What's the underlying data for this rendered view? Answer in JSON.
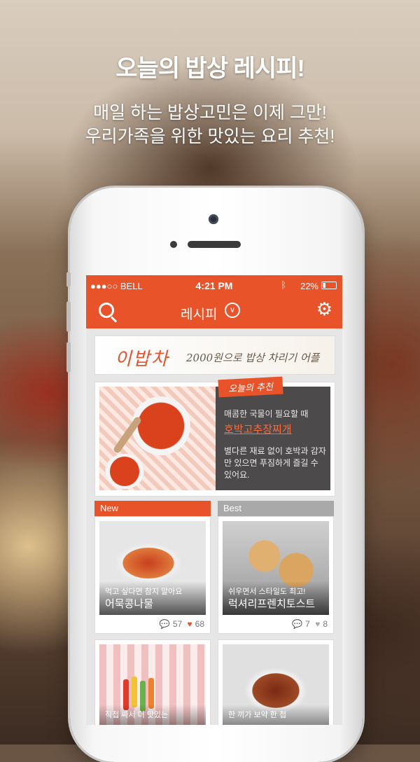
{
  "promo": {
    "headline": "오늘의 밥상 레시피!",
    "line1": "매일 하는 밥상고민은 이제 그만!",
    "line2": "우리가족을 위한 맛있는 요리 추천!"
  },
  "status_bar": {
    "carrier": "●●●○○ BELL",
    "time": "4:21 PM",
    "battery": "22%"
  },
  "nav": {
    "title": "레시피",
    "chevron": "∨"
  },
  "banner": {
    "brand": "이밥차",
    "tagline": "2000원으로 밥상 차리기 어플"
  },
  "featured": {
    "tag": "오늘의 추천",
    "subtitle": "매콤한 국물이 필요할 때",
    "title": "호박고추장찌개",
    "description": "별다른 재료 없이 호박과 감자만 있으면 푸짐하게 즐길 수 있어요."
  },
  "sections": {
    "new_label": "New",
    "best_label": "Best"
  },
  "cards": [
    {
      "subtitle": "먹고 싶다면 참지 말아요",
      "title": "어묵콩나물",
      "comments": "57",
      "likes": "68"
    },
    {
      "subtitle": "쉬우면서 스타일도 최고!",
      "title": "럭셔리프렌치토스트",
      "comments": "7",
      "likes": "8"
    },
    {
      "subtitle": "직접 싸서 더 맛있는",
      "title": "",
      "comments": "",
      "likes": ""
    },
    {
      "subtitle": "한 끼가 보약 한 첩",
      "title": "",
      "comments": "",
      "likes": ""
    }
  ],
  "colors": {
    "accent": "#e8532a",
    "best": "#a9a9a9",
    "feature_panel": "#4d4a4b"
  },
  "icons": {
    "search": "search-icon",
    "settings": "gear-icon",
    "dropdown": "chevron-down-icon",
    "comment": "comment-icon",
    "like": "heart-icon"
  }
}
